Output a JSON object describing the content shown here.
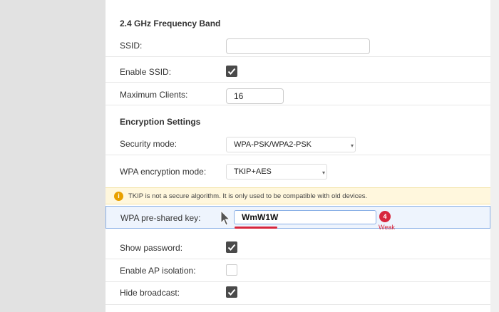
{
  "band": {
    "title": "2.4 GHz Frequency Band"
  },
  "ssid": {
    "label": "SSID:",
    "value": ""
  },
  "enable_ssid": {
    "label": "Enable SSID:",
    "checked": true
  },
  "max_clients": {
    "label": "Maximum Clients:",
    "value": "16"
  },
  "encryption": {
    "title": "Encryption Settings"
  },
  "security_mode": {
    "label": "Security mode:",
    "value": "WPA-PSK/WPA2-PSK"
  },
  "wpa_encryption": {
    "label": "WPA encryption mode:",
    "value": "TKIP+AES"
  },
  "warning": {
    "text": "TKIP is not a secure algorithm. It is only used to be compatible with old devices."
  },
  "psk": {
    "label": "WPA pre-shared key:",
    "value": "WmW1W",
    "strength_count": "4",
    "strength_label": "Weak"
  },
  "show_password": {
    "label": "Show password:",
    "checked": true
  },
  "ap_isolation": {
    "label": "Enable AP isolation:",
    "checked": false
  },
  "hide_broadcast": {
    "label": "Hide broadcast:",
    "checked": true
  },
  "colors": {
    "accent": "#4a4a4a",
    "warning_bg": "#fff7dd",
    "highlight_border": "#8ab0e6",
    "weak": "#d7263d"
  }
}
